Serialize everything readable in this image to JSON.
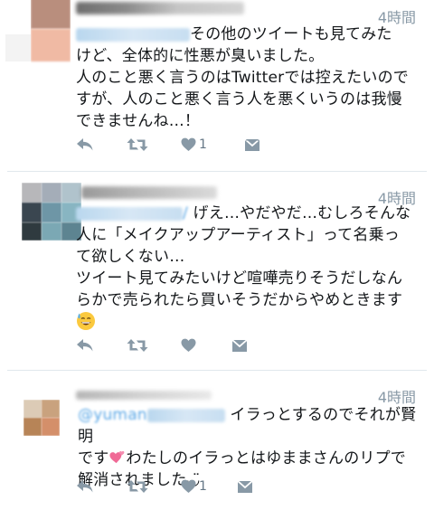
{
  "tweets": [
    {
      "mention_suffix": "",
      "text_lines": [
        "その他のツイートも見てみた",
        "けど、全体的に性悪が臭いました。",
        "人のこと悪く言うのはTwitterでは控えたいので",
        "すが、人のこと悪く言う人を悪くいうのは我慢",
        "できませんね…！"
      ],
      "timestamp": "4時間",
      "like_count": "1",
      "avatar_colors": [
        "#b98e7d",
        "#cfa89a",
        "#ffffff",
        "#f1bca6"
      ]
    },
    {
      "mention_suffix": "/",
      "text_lines": [
        "げえ…やだやだ…むしろそんな",
        "人に「メイクアップアーティスト」って名乗っ",
        "て欲しくない…",
        "ツイート見てみたいけど喧嘩売りそうだしなん",
        "らかで売られたら買いそうだからやめときます"
      ],
      "emoji": "sweat-smile-emoji",
      "timestamp": "4時間",
      "like_count": "",
      "avatar_colors": [
        "#b5b5b8",
        "#7f8da0",
        "#3d4a55",
        "#8ab9c8"
      ]
    },
    {
      "mention_prefix": "@yuman",
      "text_lines": [
        "イラっとするのでそれが賢明",
        "です",
        "わたしのイラっとはゆままさんのリプで",
        "解消されました◡̈"
      ],
      "emoji": "two-hearts-emoji",
      "timestamp": "4時間",
      "like_count": "1",
      "avatar_colors": [
        "#dccbb6",
        "#c9a27e",
        "#b78457",
        "#d9b08d"
      ]
    }
  ],
  "icons": {
    "reply": "reply-icon",
    "retweet": "retweet-icon",
    "like": "heart-icon",
    "dm": "envelope-icon"
  },
  "colors": {
    "text": "#14171a",
    "secondary": "#8899a6",
    "action_icon": "#8899a6",
    "mention": "#5aa7e6",
    "divider": "#e1e8ed"
  }
}
